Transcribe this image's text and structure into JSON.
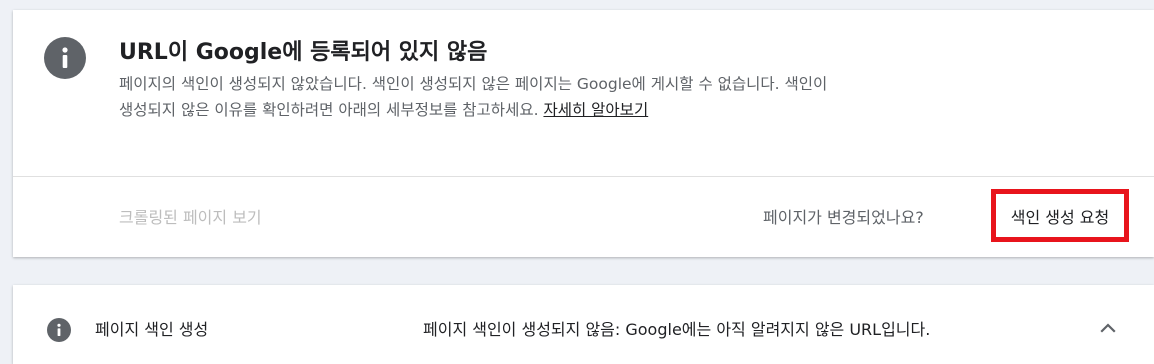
{
  "status": {
    "title": "URL이 Google에 등록되어 있지 않음",
    "description": "페이지의 색인이 생성되지 않았습니다. 색인이 생성되지 않은 페이지는 Google에 게시할 수 없습니다. 색인이 생성되지 않은 이유를 확인하려면 아래의 세부정보를 참고하세요.",
    "learn_more": "자세히 알아보기",
    "icon": "info-icon"
  },
  "actions": {
    "view_crawled": "크롤링된 페이지 보기",
    "page_changed": "페이지가 변경되었나요?",
    "request_indexing": "색인 생성 요청"
  },
  "coverage": {
    "title": "페이지 색인 생성",
    "status": "페이지 색인이 생성되지 않음: Google에는 아직 알려지지 않은 URL입니다.",
    "icon": "info-icon",
    "toggle_icon": "chevron-up-icon"
  }
}
